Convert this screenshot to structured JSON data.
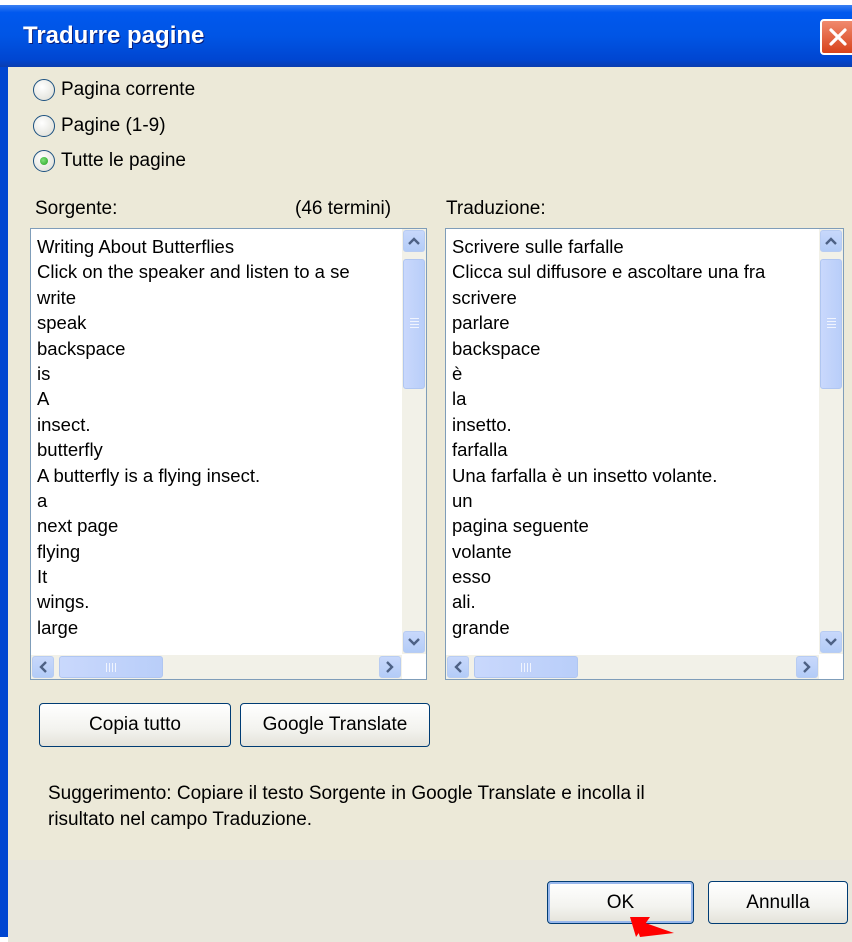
{
  "dialog": {
    "title": "Tradurre pagine",
    "close_icon": "close-icon"
  },
  "scope": {
    "options": [
      {
        "label": "Pagina corrente",
        "selected": false
      },
      {
        "label": "Pagine (1-9)",
        "selected": false
      },
      {
        "label": "Tutte le pagine",
        "selected": true
      }
    ]
  },
  "source": {
    "label": "Sorgente:",
    "count": "(46 termini)",
    "items": [
      "Writing About Butterflies",
      "Click on the speaker and listen to a se",
      "write",
      "speak",
      "backspace",
      "is",
      "A",
      "insect.",
      "butterfly",
      "A butterfly is a flying insect.",
      "a",
      "next page",
      "flying",
      "It",
      "wings.",
      "large"
    ]
  },
  "translation": {
    "label": "Traduzione:",
    "items": [
      "Scrivere sulle farfalle",
      "Clicca sul diffusore e ascoltare una fra",
      "scrivere",
      "parlare",
      "backspace",
      "è",
      "la",
      "insetto.",
      "farfalla",
      "Una farfalla è un insetto volante.",
      "un",
      "pagina seguente",
      "volante",
      "esso",
      "ali.",
      "grande"
    ]
  },
  "buttons": {
    "copy_all": "Copia tutto",
    "google_translate": "Google Translate",
    "ok": "OK",
    "cancel": "Annulla"
  },
  "hint": {
    "line1": "Suggerimento: Copiare il testo Sorgente in Google Translate e incolla il",
    "line2": "risultato nel campo Traduzione."
  },
  "colors": {
    "titlebar": "#0055E5",
    "dialog_bg": "#ECE9D8",
    "close_button": "#D8431B",
    "radio_selected": "#21A121",
    "pointer_arrow": "#FF0000"
  }
}
